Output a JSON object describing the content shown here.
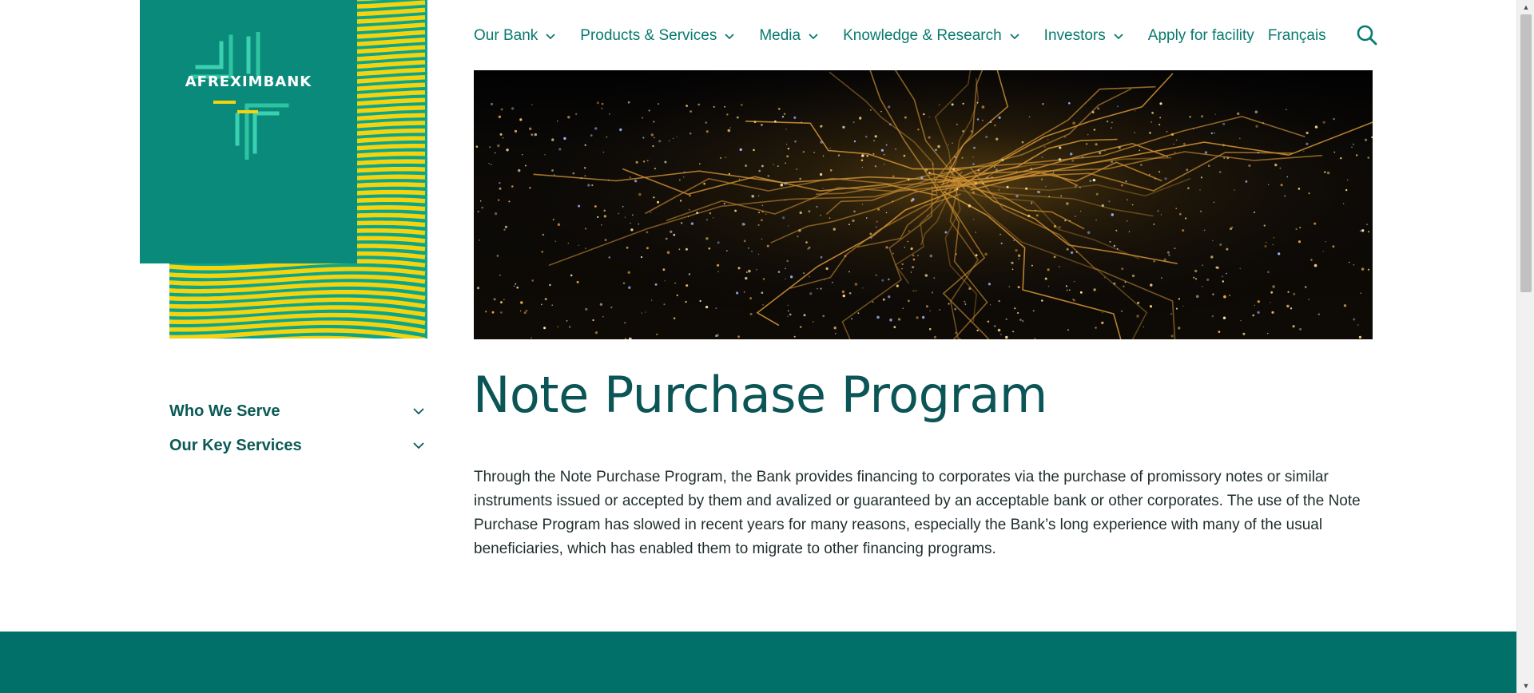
{
  "logo": {
    "text": "AFREXIMBANK",
    "colors": {
      "tile": "#0a8a7b",
      "stripe_yellow": "#f6d30d",
      "stripe_teal": "#0aa58c"
    }
  },
  "nav": {
    "items": [
      {
        "label": "Our Bank",
        "dropdown": true
      },
      {
        "label": "Products & Services",
        "dropdown": true
      },
      {
        "label": "Media",
        "dropdown": true
      },
      {
        "label": "Knowledge & Research",
        "dropdown": true
      },
      {
        "label": "Investors",
        "dropdown": true
      },
      {
        "label": "Apply for facility",
        "dropdown": false
      },
      {
        "label": "Français",
        "dropdown": false
      }
    ],
    "search_icon": "search-icon"
  },
  "sidebar": {
    "items": [
      {
        "label": "Who We Serve",
        "icon": "chevron-down-icon"
      },
      {
        "label": "Our Key Services",
        "icon": "chevron-down-icon"
      }
    ]
  },
  "main": {
    "title": "Note Purchase Program",
    "body": "Through the Note Purchase Program, the Bank provides financing to corporates via the purchase of promissory notes or similar instruments issued or accepted by them and avalized or guaranteed by an acceptable bank or other corporates. The use of the Note Purchase Program has slowed in recent years for many reasons, especially the Bank’s long experience with many of the usual beneficiaries, which has enabled them to migrate to other financing programs."
  },
  "theme": {
    "accent": "#087a70",
    "heading": "#0c5556",
    "footer": "#007068"
  }
}
